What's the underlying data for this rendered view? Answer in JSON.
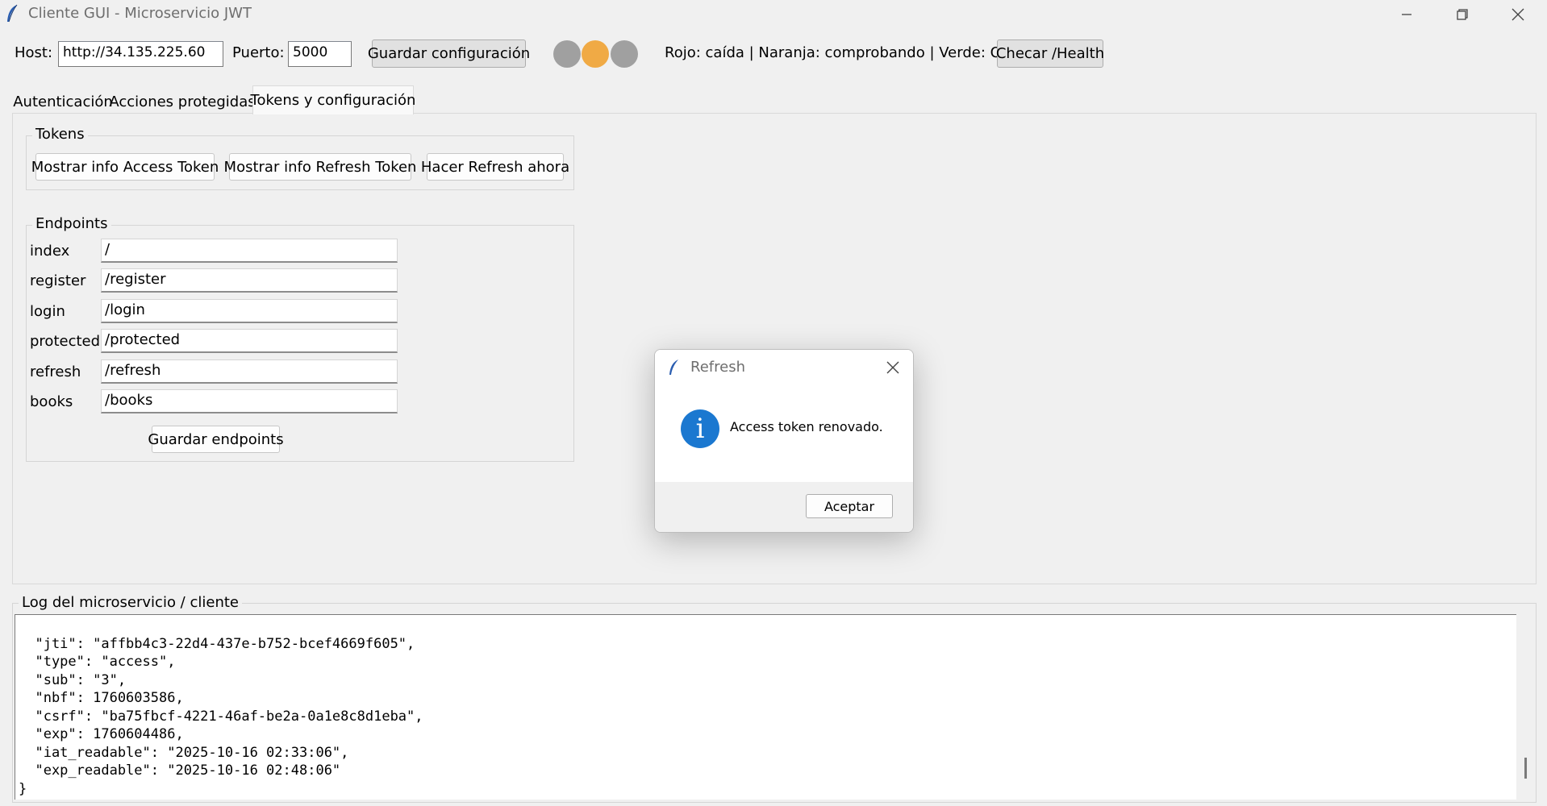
{
  "window": {
    "title": "Cliente GUI - Microservicio JWT"
  },
  "toolbar": {
    "host_label": "Host:",
    "host_value": "http://34.135.225.60",
    "port_label": "Puerto:",
    "port_value": "5000",
    "save_config_label": "Guardar configuración",
    "status_lights": [
      {
        "name": "red-light",
        "color": "#a0a0a0"
      },
      {
        "name": "orange-light",
        "color": "#f0aa45"
      },
      {
        "name": "green-light",
        "color": "#a0a0a0"
      }
    ],
    "legend_text": "Rojo: caída | Naranja: comprobando | Verde: OK",
    "health_label": "Checar /Health"
  },
  "tabs": [
    {
      "label": "Autenticación",
      "active": false
    },
    {
      "label": "Acciones protegidas",
      "active": false
    },
    {
      "label": "Tokens y configuración",
      "active": true
    }
  ],
  "tokens_group": {
    "title": "Tokens",
    "buttons": {
      "access_info": "Mostrar info Access Token",
      "refresh_info": "Mostrar info Refresh Token",
      "refresh_now": "Hacer Refresh ahora"
    }
  },
  "endpoints_group": {
    "title": "Endpoints",
    "rows": [
      {
        "label": "index",
        "value": "/"
      },
      {
        "label": "register",
        "value": "/register"
      },
      {
        "label": "login",
        "value": "/login"
      },
      {
        "label": "protected",
        "value": "/protected"
      },
      {
        "label": "refresh",
        "value": "/refresh"
      },
      {
        "label": "books",
        "value": "/books"
      }
    ],
    "save_label": "Guardar endpoints"
  },
  "log": {
    "title": "Log del microservicio / cliente",
    "lines": [
      "  \"jti\": \"affbb4c3-22d4-437e-b752-bcef4669f605\",",
      "  \"type\": \"access\",",
      "  \"sub\": \"3\",",
      "  \"nbf\": 1760603586,",
      "  \"csrf\": \"ba75fbcf-4221-46af-be2a-0a1e8c8d1eba\",",
      "  \"exp\": 1760604486,",
      "  \"iat_readable\": \"2025-10-16 02:33:06\",",
      "  \"exp_readable\": \"2025-10-16 02:48:06\"",
      "}"
    ]
  },
  "dialog": {
    "title": "Refresh",
    "message": "Access token renovado.",
    "ok_label": "Aceptar",
    "icon": "info-icon"
  }
}
